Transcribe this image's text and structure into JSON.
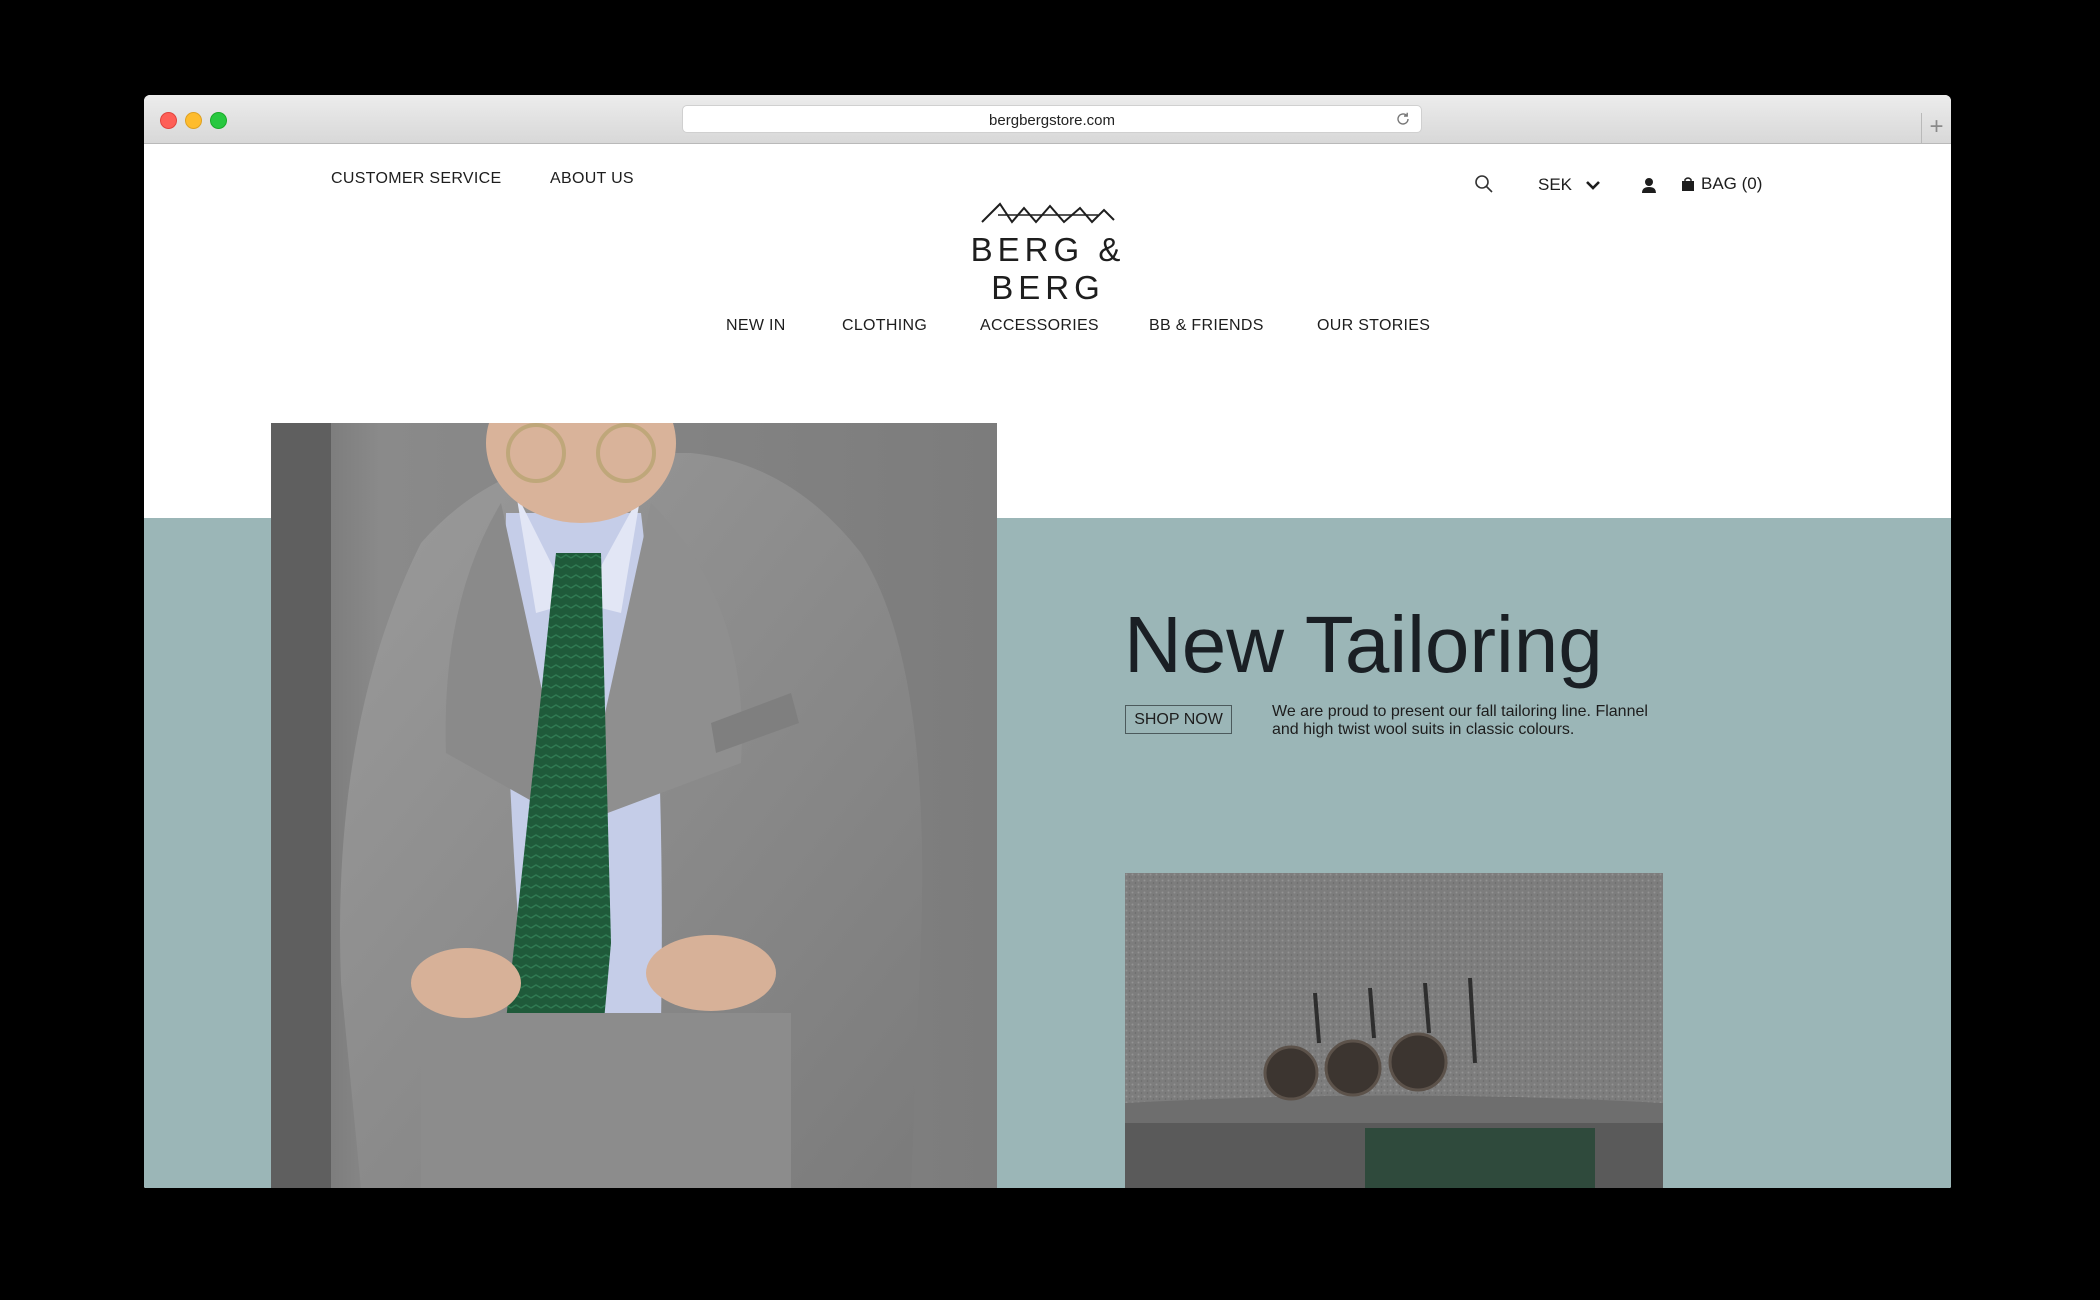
{
  "browser": {
    "url": "bergbergstore.com",
    "new_tab_label": "+"
  },
  "header": {
    "top_links": [
      "CUSTOMER SERVICE",
      "ABOUT US"
    ],
    "logo_text": "BERG & BERG",
    "currency": "SEK",
    "bag_label": "BAG (0)"
  },
  "nav": {
    "items": [
      "NEW IN",
      "CLOTHING",
      "ACCESSORIES",
      "BB & FRIENDS",
      "OUR STORIES"
    ]
  },
  "hero": {
    "title": "New Tailoring",
    "cta_label": "SHOP NOW",
    "description": "We are proud to present our fall tailoring line. Flannel and high twist wool suits in classic colours."
  },
  "colors": {
    "band": "#9bb6b7",
    "text": "#1d1d1d",
    "suit_grey": "#8c8c8c",
    "tie_green": "#1f5a3a"
  },
  "icons": {
    "search": "search-icon",
    "chevron": "chevron-down-icon",
    "user": "user-icon",
    "bag": "bag-icon",
    "reload": "reload-icon"
  }
}
